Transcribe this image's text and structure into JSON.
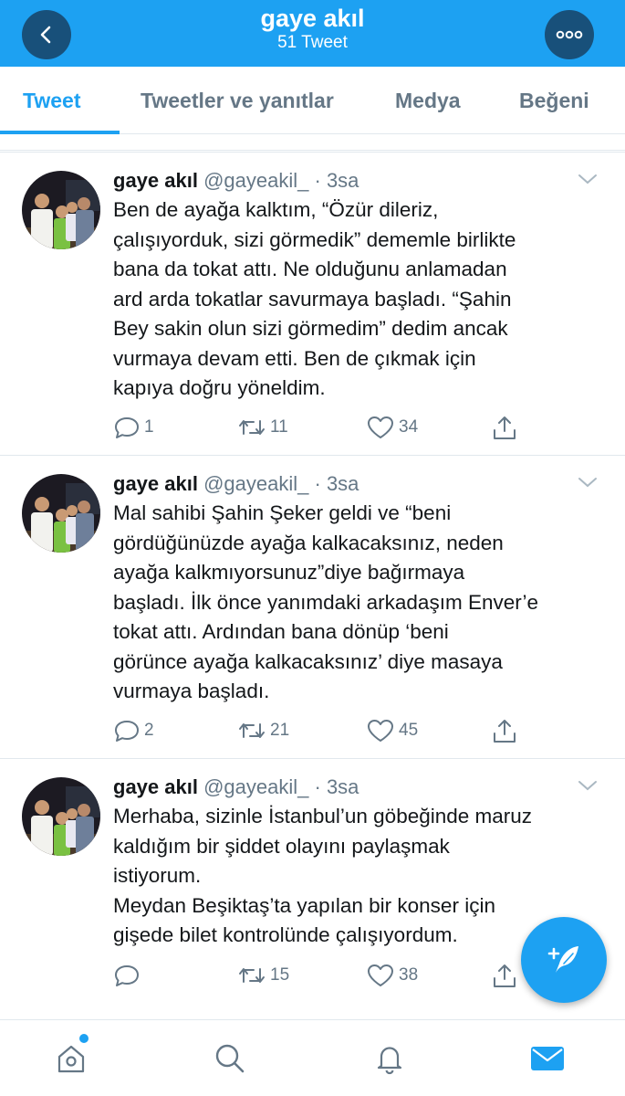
{
  "header": {
    "title": "gaye akıl",
    "subtitle": "51 Tweet",
    "bg_color": "#1da1f2",
    "back_icon": "chevron-left-icon",
    "more_icon": "more-dots-icon"
  },
  "tabs": [
    {
      "label": "Tweet",
      "active": true
    },
    {
      "label": "Tweetler ve yanıtlar",
      "active": false
    },
    {
      "label": "Medya",
      "active": false
    },
    {
      "label": "Beğeni",
      "active": false
    }
  ],
  "tweets": [
    {
      "name": "gaye akıl",
      "handle": "@gayeakil_",
      "time": "· 3sa",
      "text": "Ben de ayağa kalktım, “Özür dileriz,\nçalışıyorduk,  sizi görmedik” dememle birlikte\nbana da tokat attı. Ne olduğunu anlamadan\nard arda tokatlar savurmaya başladı. “Şahin\nBey sakin  olun  sizi görmedim” dedim ancak\nvurmaya devam etti. Ben de çıkmak için\nkapıya  doğru yöneldim.",
      "replies": "1",
      "retweets": "11",
      "likes": "34"
    },
    {
      "name": "gaye akıl",
      "handle": "@gayeakil_",
      "time": "· 3sa",
      "text": "Mal sahibi  Şahin Şeker geldi ve “beni\ngördüğünüzde ayağa kalkacaksınız, neden\nayağa kalkmıyorsunuz”diye bağırmaya\nbaşladı. İlk önce yanımdaki arkadaşım Enver’e\ntokat  attı. Ardından bana dönüp ‘beni\ngörünce ayağa kalkacaksınız’ diye masaya\nvurmaya başladı.",
      "replies": "2",
      "retweets": "21",
      "likes": "45"
    },
    {
      "name": "gaye akıl",
      "handle": "@gayeakil_",
      "time": "· 3sa",
      "text": "Merhaba, sizinle İstanbul’un göbeğinde maruz\nkaldığım bir şiddet olayını paylaşmak\nistiyorum.\nMeydan Beşiktaş’ta yapılan bir konser için\ngişede bilet kontrolünde çalışıyordum.",
      "replies": "",
      "retweets": "15",
      "likes": "38"
    }
  ],
  "fab": {
    "icon": "compose-tweet-icon"
  },
  "bottom_nav": [
    {
      "icon": "home-icon",
      "has_notification_dot": true
    },
    {
      "icon": "search-icon"
    },
    {
      "icon": "notifications-bell-icon"
    },
    {
      "icon": "messages-envelope-icon",
      "active": true
    }
  ],
  "colors": {
    "accent": "#1da1f2",
    "muted": "#657786",
    "text": "#14171a",
    "border": "#e1e8ed"
  }
}
